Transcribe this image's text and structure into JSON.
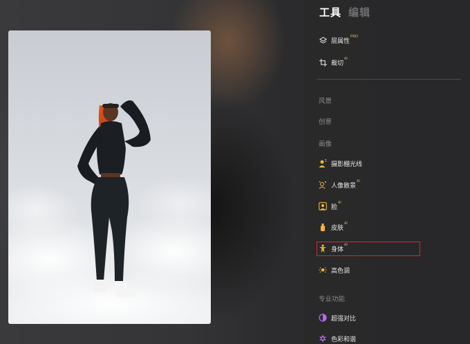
{
  "tabs": [
    {
      "label": "工具",
      "active": true
    },
    {
      "label": "编辑",
      "active": false
    }
  ],
  "tools": [
    {
      "label": "层属性",
      "badge": "PRO",
      "icon": "layers-icon"
    },
    {
      "label": "裁切",
      "badge": "AI",
      "icon": "crop-icon"
    }
  ],
  "sections": {
    "landscape": "风景",
    "creative": "创意",
    "portrait": "画像",
    "pro": "专业功能"
  },
  "portrait_items": [
    {
      "label": "摄影棚光线",
      "badge": "",
      "icon": "studio-light-icon"
    },
    {
      "label": "人像散景",
      "badge": "AI",
      "icon": "portrait-bokeh-icon"
    },
    {
      "label": "脸",
      "badge": "AI",
      "icon": "face-icon"
    },
    {
      "label": "皮肤",
      "badge": "AI",
      "icon": "skin-icon"
    },
    {
      "label": "身体",
      "badge": "AI",
      "icon": "body-icon"
    },
    {
      "label": "高色调",
      "badge": "",
      "icon": "high-key-icon"
    }
  ],
  "pro_items": [
    {
      "label": "超强对比",
      "badge": "",
      "icon": "contrast-icon"
    },
    {
      "label": "色彩和谐",
      "badge": "",
      "icon": "color-harmony-icon"
    }
  ],
  "colors": {
    "accent_icon": "#f0b43c",
    "highlight_box": "#d9262c",
    "pro_icon": "#b468f0"
  }
}
